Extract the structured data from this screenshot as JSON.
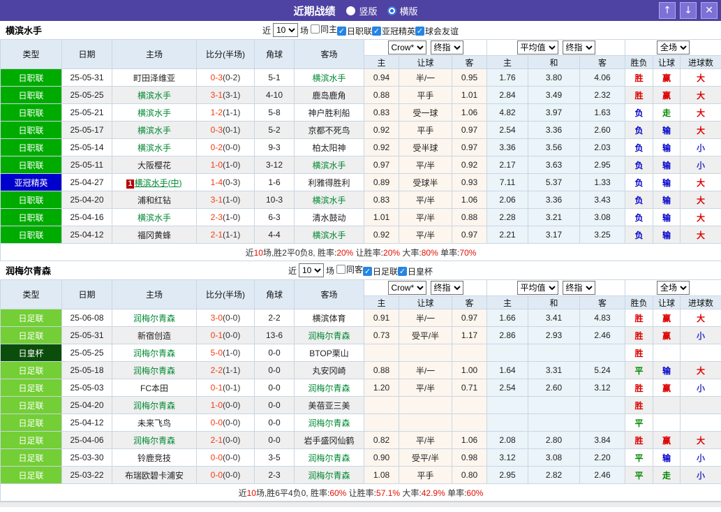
{
  "title_bar": {
    "title": "近期战绩",
    "radios": [
      {
        "label": "竖版",
        "selected": false
      },
      {
        "label": "横版",
        "selected": true
      }
    ],
    "up_icon": "↑",
    "down_icon": "↓",
    "close_icon": "✕"
  },
  "columns": {
    "type": "类型",
    "date": "日期",
    "home": "主场",
    "score": "比分(半场)",
    "corner": "角球",
    "away": "客场",
    "crow_select": "Crow*",
    "crow_final_select": "终指",
    "avg_select": "平均值",
    "avg_final_select": "终指",
    "scope_select": "全场",
    "crow_home": "主",
    "crow_handicap": "让球",
    "crow_away": "客",
    "avg_home": "主",
    "avg_draw": "和",
    "avg_away": "客",
    "result": "胜负",
    "handicap_result": "让球",
    "goals": "进球数"
  },
  "colors": {
    "titlebar": "#4e43a2",
    "type": {
      "日职联": "#00ab00",
      "亚冠精英": "#0000cc",
      "日足联": "#74ce35",
      "日皇杯": "#0b4d0b"
    },
    "outcome": {
      "胜": "#dd0000",
      "平": "#008800",
      "负": "#0000cc",
      "赢": "#dd0000",
      "走": "#008800",
      "输": "#0000cc",
      "大": "#dd0000",
      "小": "#3333cc"
    }
  },
  "sections": [
    {
      "team": "横滨水手",
      "filters": {
        "near": "近",
        "count": "10",
        "matches": "场",
        "checkboxes": [
          {
            "label": "同主",
            "checked": false
          },
          {
            "label": "日职联",
            "checked": true
          },
          {
            "label": "亚冠精英",
            "checked": true
          },
          {
            "label": "球会友谊",
            "checked": true
          }
        ]
      },
      "rows": [
        {
          "type": "日职联",
          "date": "25-05-31",
          "home": {
            "name": "町田泽维亚"
          },
          "score": "0-3",
          "half": "(0-2)",
          "corner": "5-1",
          "away": {
            "name": "横滨水手",
            "green": true
          },
          "crow": [
            "0.94",
            "半/一",
            "0.95"
          ],
          "avg": [
            "1.76",
            "3.80",
            "4.06"
          ],
          "result": "胜",
          "handicap_result": "赢",
          "goal_result": "大"
        },
        {
          "type": "日职联",
          "date": "25-05-25",
          "home": {
            "name": "横滨水手",
            "green": true
          },
          "score": "3-1",
          "half": "(3-1)",
          "corner": "4-10",
          "away": {
            "name": "鹿岛鹿角"
          },
          "crow": [
            "0.88",
            "平手",
            "1.01"
          ],
          "avg": [
            "2.84",
            "3.49",
            "2.32"
          ],
          "result": "胜",
          "handicap_result": "赢",
          "goal_result": "大"
        },
        {
          "type": "日职联",
          "date": "25-05-21",
          "home": {
            "name": "横滨水手",
            "green": true
          },
          "score": "1-2",
          "half": "(1-1)",
          "corner": "5-8",
          "away": {
            "name": "神户胜利船"
          },
          "crow": [
            "0.83",
            "受一球",
            "1.06"
          ],
          "avg": [
            "4.82",
            "3.97",
            "1.63"
          ],
          "result": "负",
          "handicap_result": "走",
          "goal_result": "大"
        },
        {
          "type": "日职联",
          "date": "25-05-17",
          "home": {
            "name": "横滨水手",
            "green": true
          },
          "score": "0-3",
          "half": "(0-1)",
          "corner": "5-2",
          "away": {
            "name": "京都不死鸟"
          },
          "crow": [
            "0.92",
            "平手",
            "0.97"
          ],
          "avg": [
            "2.54",
            "3.36",
            "2.60"
          ],
          "result": "负",
          "handicap_result": "输",
          "goal_result": "大"
        },
        {
          "type": "日职联",
          "date": "25-05-14",
          "home": {
            "name": "横滨水手",
            "green": true
          },
          "score": "0-2",
          "half": "(0-0)",
          "corner": "9-3",
          "away": {
            "name": "柏太阳神"
          },
          "crow": [
            "0.92",
            "受半球",
            "0.97"
          ],
          "avg": [
            "3.36",
            "3.56",
            "2.03"
          ],
          "result": "负",
          "handicap_result": "输",
          "goal_result": "小"
        },
        {
          "type": "日职联",
          "date": "25-05-11",
          "home": {
            "name": "大阪樱花"
          },
          "score": "1-0",
          "half": "(1-0)",
          "corner": "3-12",
          "away": {
            "name": "横滨水手",
            "green": true
          },
          "crow": [
            "0.97",
            "平/半",
            "0.92"
          ],
          "avg": [
            "2.17",
            "3.63",
            "2.95"
          ],
          "result": "负",
          "handicap_result": "输",
          "goal_result": "小"
        },
        {
          "type": "亚冠精英",
          "date": "25-04-27",
          "home": {
            "name": "横滨水手(中)",
            "green": true,
            "badge": "1",
            "link": true
          },
          "score": "1-4",
          "half": "(0-3)",
          "corner": "1-6",
          "away": {
            "name": "利雅得胜利"
          },
          "crow": [
            "0.89",
            "受球半",
            "0.93"
          ],
          "avg": [
            "7.11",
            "5.37",
            "1.33"
          ],
          "result": "负",
          "handicap_result": "输",
          "goal_result": "大"
        },
        {
          "type": "日职联",
          "date": "25-04-20",
          "home": {
            "name": "浦和红钻"
          },
          "score": "3-1",
          "half": "(1-0)",
          "corner": "10-3",
          "away": {
            "name": "横滨水手",
            "green": true
          },
          "crow": [
            "0.83",
            "平/半",
            "1.06"
          ],
          "avg": [
            "2.06",
            "3.36",
            "3.43"
          ],
          "result": "负",
          "handicap_result": "输",
          "goal_result": "大"
        },
        {
          "type": "日职联",
          "date": "25-04-16",
          "home": {
            "name": "横滨水手",
            "green": true
          },
          "score": "2-3",
          "half": "(1-0)",
          "corner": "6-3",
          "away": {
            "name": "清水鼓动"
          },
          "crow": [
            "1.01",
            "平/半",
            "0.88"
          ],
          "avg": [
            "2.28",
            "3.21",
            "3.08"
          ],
          "result": "负",
          "handicap_result": "输",
          "goal_result": "大"
        },
        {
          "type": "日职联",
          "date": "25-04-12",
          "home": {
            "name": "福冈黄蜂"
          },
          "score": "2-1",
          "half": "(1-1)",
          "corner": "4-4",
          "away": {
            "name": "横滨水手",
            "green": true
          },
          "crow": [
            "0.92",
            "平/半",
            "0.97"
          ],
          "avg": [
            "2.21",
            "3.17",
            "3.25"
          ],
          "result": "负",
          "handicap_result": "输",
          "goal_result": "大"
        }
      ],
      "summary": [
        {
          "text": "近",
          "red": false
        },
        {
          "text": "10",
          "red": true
        },
        {
          "text": "场,胜2平0负8, 胜率:",
          "red": false
        },
        {
          "text": "20%",
          "red": true
        },
        {
          "text": " 让胜率:",
          "red": false
        },
        {
          "text": "20%",
          "red": true
        },
        {
          "text": " 大率:",
          "red": false
        },
        {
          "text": "80%",
          "red": true
        },
        {
          "text": " 单率:",
          "red": false
        },
        {
          "text": "70%",
          "red": true
        }
      ]
    },
    {
      "team": "润梅尔青森",
      "filters": {
        "near": "近",
        "count": "10",
        "matches": "场",
        "checkboxes": [
          {
            "label": "同客",
            "checked": false
          },
          {
            "label": "日足联",
            "checked": true
          },
          {
            "label": "日皇杯",
            "checked": true
          }
        ]
      },
      "rows": [
        {
          "type": "日足联",
          "date": "25-06-08",
          "home": {
            "name": "润梅尔青森",
            "green": true
          },
          "score": "3-0",
          "half": "(0-0)",
          "corner": "2-2",
          "away": {
            "name": "横滨体育"
          },
          "crow": [
            "0.91",
            "半/一",
            "0.97"
          ],
          "avg": [
            "1.66",
            "3.41",
            "4.83"
          ],
          "result": "胜",
          "handicap_result": "赢",
          "goal_result": "大"
        },
        {
          "type": "日足联",
          "date": "25-05-31",
          "home": {
            "name": "新宿创造"
          },
          "score": "0-1",
          "half": "(0-0)",
          "corner": "13-6",
          "away": {
            "name": "润梅尔青森",
            "green": true
          },
          "crow": [
            "0.73",
            "受平/半",
            "1.17"
          ],
          "avg": [
            "2.86",
            "2.93",
            "2.46"
          ],
          "result": "胜",
          "handicap_result": "赢",
          "goal_result": "小"
        },
        {
          "type": "日皇杯",
          "date": "25-05-25",
          "home": {
            "name": "润梅尔青森",
            "green": true
          },
          "score": "5-0",
          "half": "(1-0)",
          "corner": "0-0",
          "away": {
            "name": "BTOP栗山"
          },
          "crow": [
            "",
            "",
            ""
          ],
          "avg": [
            "",
            "",
            ""
          ],
          "result": "胜",
          "handicap_result": "",
          "goal_result": ""
        },
        {
          "type": "日足联",
          "date": "25-05-18",
          "home": {
            "name": "润梅尔青森",
            "green": true
          },
          "score": "2-2",
          "half": "(1-1)",
          "corner": "0-0",
          "away": {
            "name": "丸安冈崎"
          },
          "crow": [
            "0.88",
            "半/一",
            "1.00"
          ],
          "avg": [
            "1.64",
            "3.31",
            "5.24"
          ],
          "result": "平",
          "handicap_result": "输",
          "goal_result": "大"
        },
        {
          "type": "日足联",
          "date": "25-05-03",
          "home": {
            "name": "FC本田"
          },
          "score": "0-1",
          "half": "(0-1)",
          "corner": "0-0",
          "away": {
            "name": "润梅尔青森",
            "green": true
          },
          "crow": [
            "1.20",
            "平/半",
            "0.71"
          ],
          "avg": [
            "2.54",
            "2.60",
            "3.12"
          ],
          "result": "胜",
          "handicap_result": "赢",
          "goal_result": "小"
        },
        {
          "type": "日足联",
          "date": "25-04-20",
          "home": {
            "name": "润梅尔青森",
            "green": true
          },
          "score": "1-0",
          "half": "(0-0)",
          "corner": "0-0",
          "away": {
            "name": "美蓓亚三美"
          },
          "crow": [
            "",
            "",
            ""
          ],
          "avg": [
            "",
            "",
            ""
          ],
          "result": "胜",
          "handicap_result": "",
          "goal_result": ""
        },
        {
          "type": "日足联",
          "date": "25-04-12",
          "home": {
            "name": "未来飞鸟"
          },
          "score": "0-0",
          "half": "(0-0)",
          "corner": "0-0",
          "away": {
            "name": "润梅尔青森",
            "green": true
          },
          "crow": [
            "",
            "",
            ""
          ],
          "avg": [
            "",
            "",
            ""
          ],
          "result": "平",
          "handicap_result": "",
          "goal_result": ""
        },
        {
          "type": "日足联",
          "date": "25-04-06",
          "home": {
            "name": "润梅尔青森",
            "green": true
          },
          "score": "2-1",
          "half": "(0-0)",
          "corner": "0-0",
          "away": {
            "name": "岩手盛冈仙鹤"
          },
          "crow": [
            "0.82",
            "平/半",
            "1.06"
          ],
          "avg": [
            "2.08",
            "2.80",
            "3.84"
          ],
          "result": "胜",
          "handicap_result": "赢",
          "goal_result": "大"
        },
        {
          "type": "日足联",
          "date": "25-03-30",
          "home": {
            "name": "铃鹿竞技"
          },
          "score": "0-0",
          "half": "(0-0)",
          "corner": "3-5",
          "away": {
            "name": "润梅尔青森",
            "green": true
          },
          "crow": [
            "0.90",
            "受平/半",
            "0.98"
          ],
          "avg": [
            "3.12",
            "3.08",
            "2.20"
          ],
          "result": "平",
          "handicap_result": "输",
          "goal_result": "小"
        },
        {
          "type": "日足联",
          "date": "25-03-22",
          "home": {
            "name": "布瑞欧碧卡浦安"
          },
          "score": "0-0",
          "half": "(0-0)",
          "corner": "2-3",
          "away": {
            "name": "润梅尔青森",
            "green": true
          },
          "crow": [
            "1.08",
            "平手",
            "0.80"
          ],
          "avg": [
            "2.95",
            "2.82",
            "2.46"
          ],
          "result": "平",
          "handicap_result": "走",
          "goal_result": "小"
        }
      ],
      "summary": [
        {
          "text": "近",
          "red": false
        },
        {
          "text": "10",
          "red": true
        },
        {
          "text": "场,胜6平4负0, 胜率:",
          "red": false
        },
        {
          "text": "60%",
          "red": true
        },
        {
          "text": " 让胜率:",
          "red": false
        },
        {
          "text": "57.1%",
          "red": true
        },
        {
          "text": " 大率:",
          "red": false
        },
        {
          "text": "42.9%",
          "red": true
        },
        {
          "text": " 单率:",
          "red": false
        },
        {
          "text": "60%",
          "red": true
        }
      ]
    }
  ]
}
